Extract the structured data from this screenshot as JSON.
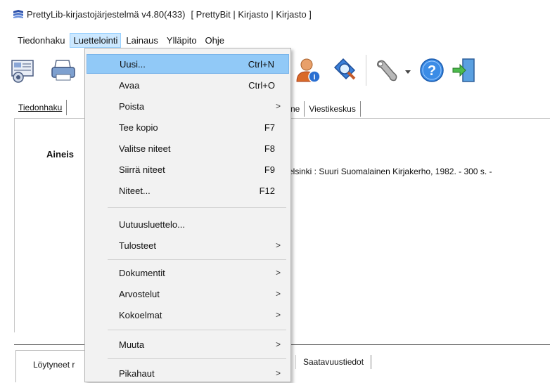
{
  "window": {
    "title": "PrettyLib-kirjastojärjestelmä v4.80(433)",
    "context": "[ PrettyBit | Kirjasto | Kirjasto ]"
  },
  "menubar": [
    "Tiedonhaku",
    "Luettelointi",
    "Lainaus",
    "Ylläpito",
    "Ohje"
  ],
  "tabs_top": {
    "first": "Tiedonhaku",
    "hidden_fragment": "ne",
    "viestikeskus": "Viestikeskus"
  },
  "content": {
    "label": "Aineis",
    "record": "elsinki : Suuri Suomalainen Kirjakerho, 1982. - 300 s. -"
  },
  "bottom_tabs": {
    "first": "Löytyneet r",
    "saatavuus": "Saatavuustiedot"
  },
  "dropdown": {
    "items": [
      {
        "label": "Uusi...",
        "shortcut": "Ctrl+N",
        "submenu": false,
        "highlighted": true
      },
      {
        "label": "Avaa",
        "shortcut": "Ctrl+O",
        "submenu": false
      },
      {
        "label": "Poista",
        "shortcut": "",
        "submenu": true
      },
      {
        "label": "Tee kopio",
        "shortcut": "F7",
        "submenu": false
      },
      {
        "label": "Valitse niteet",
        "shortcut": "F8",
        "submenu": false
      },
      {
        "label": "Siirrä niteet",
        "shortcut": "F9",
        "submenu": false
      },
      {
        "label": "Niteet...",
        "shortcut": "F12",
        "submenu": false
      },
      {
        "label": "Uutuusluettelo...",
        "shortcut": "",
        "submenu": false
      },
      {
        "label": "Tulosteet",
        "shortcut": "",
        "submenu": true
      },
      {
        "label": "Dokumentit",
        "shortcut": "",
        "submenu": true
      },
      {
        "label": "Arvostelut",
        "shortcut": "",
        "submenu": true
      },
      {
        "label": "Kokoelmat",
        "shortcut": "",
        "submenu": true
      },
      {
        "label": "Muuta",
        "shortcut": "",
        "submenu": true
      },
      {
        "label": "Pikahaut",
        "shortcut": "",
        "submenu": true
      }
    ]
  },
  "colors": {
    "menu_highlight": "#91c9f7",
    "menubar_active": "#cce8ff",
    "dropdown_bg": "#f2f2f2"
  },
  "icons": [
    "catalog-card-icon",
    "printer-icon",
    "person-info-icon",
    "magnifier-tag-icon",
    "wrench-icon",
    "dropdown-arrow-icon",
    "help-icon",
    "exit-door-icon"
  ]
}
